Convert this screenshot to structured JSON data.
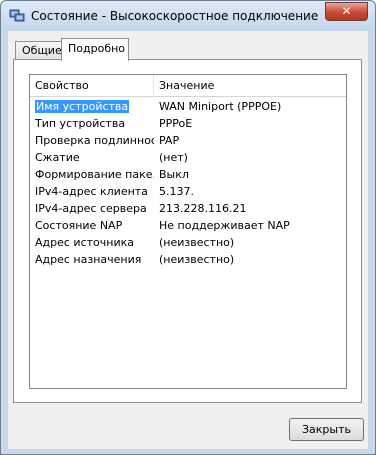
{
  "window": {
    "title": "Состояние - Высокоскоростное подключение",
    "close_glyph": "✕"
  },
  "tabs": [
    {
      "label": "Общие"
    },
    {
      "label": "Подробно"
    }
  ],
  "details": {
    "columns": {
      "property": "Свойство",
      "value": "Значение"
    },
    "rows": [
      {
        "property": "Имя устройства",
        "value": "WAN Miniport (PPPOE)"
      },
      {
        "property": "Тип устройства",
        "value": "PPPoE"
      },
      {
        "property": "Проверка подлинности",
        "value": "PAP"
      },
      {
        "property": "Сжатие",
        "value": "(нет)"
      },
      {
        "property": "Формирование паке...",
        "value": "Выкл"
      },
      {
        "property": "IPv4-адрес клиента",
        "value": "5.137."
      },
      {
        "property": "IPv4-адрес сервера",
        "value": "213.228.116.21"
      },
      {
        "property": "Состояние NAP",
        "value": "Не поддерживает NAP"
      },
      {
        "property": "Адрес источника",
        "value": "(неизвестно)"
      },
      {
        "property": "Адрес назначения",
        "value": "(неизвестно)"
      }
    ]
  },
  "buttons": {
    "close": "Закрыть"
  },
  "colors": {
    "selection": "#3399ff",
    "close_button": "#c74a35"
  }
}
